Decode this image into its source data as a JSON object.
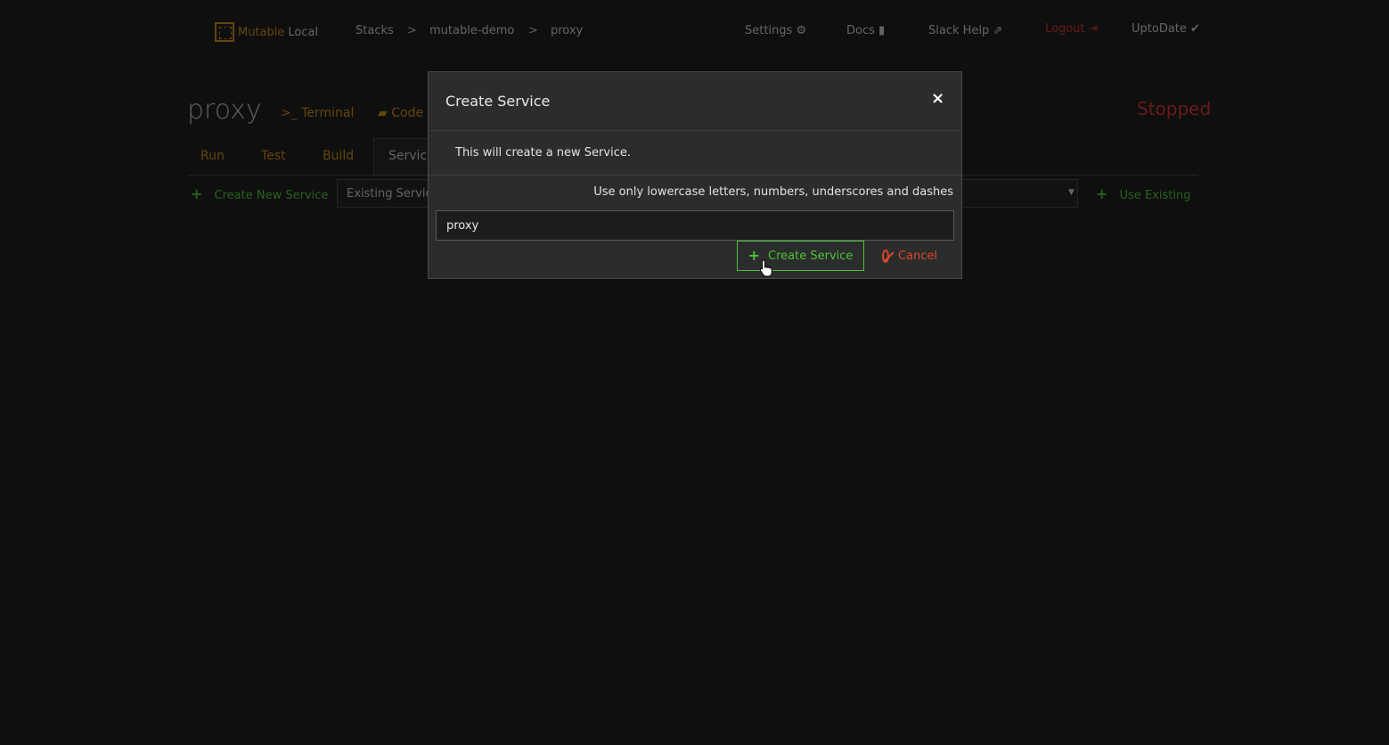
{
  "nav": {
    "brand_primary": "Mutable",
    "brand_secondary": "Local",
    "breadcrumb": [
      "Stacks",
      "mutable-demo",
      "proxy"
    ],
    "breadcrumb_separator": ">",
    "settings": "Settings",
    "docs": "Docs",
    "slack_help": "Slack Help",
    "logout": "Logout",
    "uptodate": "UptoDate"
  },
  "page": {
    "title": "proxy",
    "terminal_link": "Terminal",
    "code_link": "Code",
    "status": "Stopped"
  },
  "tabs": [
    "Run",
    "Test",
    "Build",
    "Service"
  ],
  "actions": {
    "create_new": "Create New Service",
    "existing_placeholder": "Existing Service",
    "use_existing": "Use Existing"
  },
  "modal": {
    "title": "Create Service",
    "close": "×",
    "description": "This will create a new Service.",
    "hint": "Use only lowercase letters, numbers, underscores and dashes",
    "input_value": "proxy",
    "create_label": "Create Service",
    "cancel_label": "Cancel"
  },
  "colors": {
    "accent_orange": "#c88a1c",
    "accent_green": "#4fc23b",
    "danger_red": "#e0452d",
    "status_red": "#d23434"
  }
}
